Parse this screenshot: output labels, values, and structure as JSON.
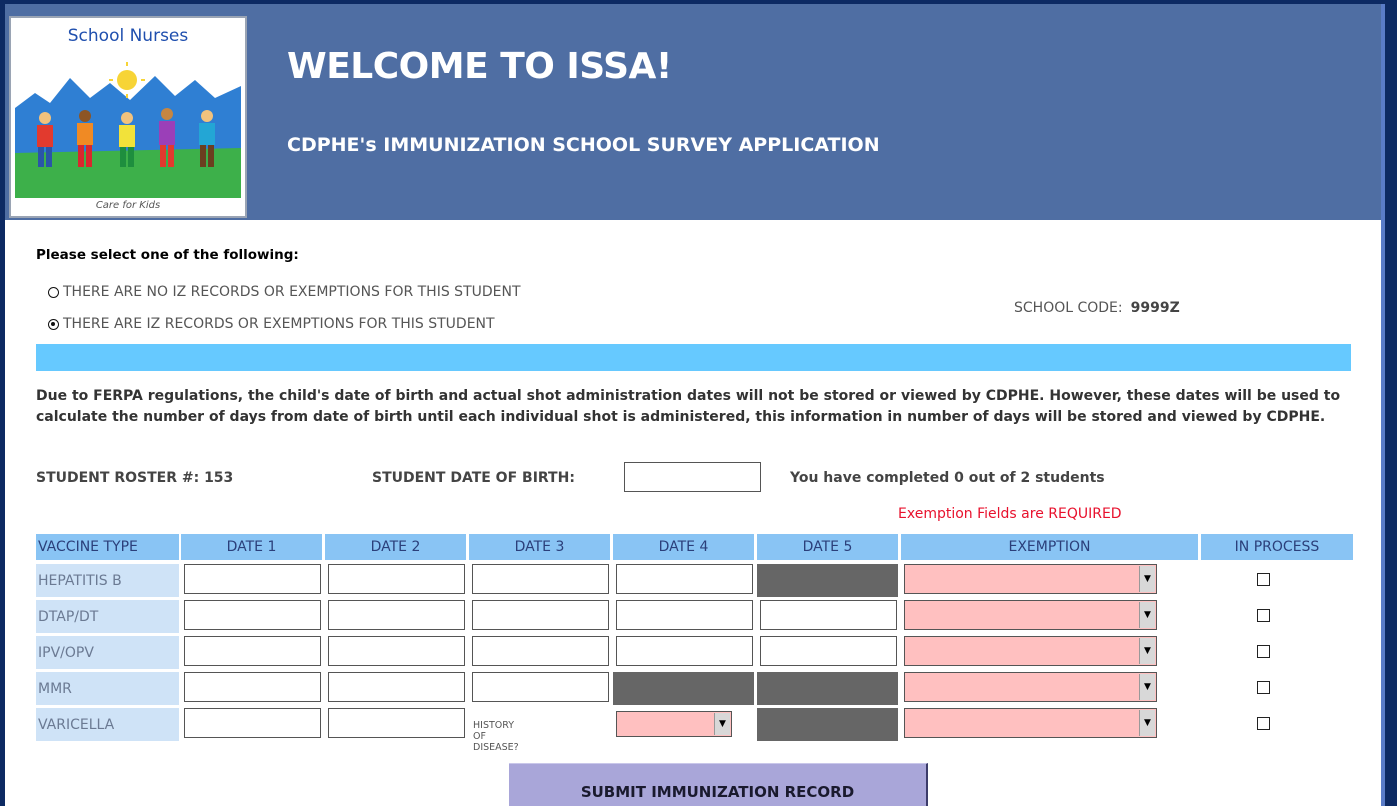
{
  "header": {
    "logo_top_text": "School Nurses",
    "logo_bottom_text": "Care for Kids",
    "title": "WELCOME TO ISSA!",
    "subtitle": "CDPHE's IMMUNIZATION SCHOOL SURVEY APPLICATION"
  },
  "selection": {
    "prompt": "Please select one of the following:",
    "options": [
      {
        "label": "THERE ARE NO IZ RECORDS OR EXEMPTIONS FOR THIS STUDENT",
        "checked": false
      },
      {
        "label": "THERE ARE IZ RECORDS OR EXEMPTIONS FOR THIS STUDENT",
        "checked": true
      }
    ]
  },
  "school": {
    "label": "SCHOOL CODE:",
    "value": "9999Z"
  },
  "notice": "Due to FERPA regulations, the child's date of birth and actual shot administration dates will not be stored or viewed by CDPHE. However, these dates will be used to calculate the number of days from date of birth until each individual shot is administered, this information in number of days will be stored and viewed by CDPHE.",
  "student": {
    "roster_label": "STUDENT ROSTER #:",
    "roster_value": "153",
    "dob_label": "STUDENT DATE OF BIRTH:",
    "dob_value": "",
    "progress_text": "You have completed 0  out of 2 students"
  },
  "required_note": "Exemption Fields are REQUIRED",
  "table": {
    "headers": [
      "VACCINE TYPE",
      "DATE 1",
      "DATE 2",
      "DATE 3",
      "DATE 4",
      "DATE 5",
      "EXEMPTION",
      "IN PROCESS"
    ],
    "rows": [
      {
        "label": "HEPATITIS B"
      },
      {
        "label": "DTAP/DT"
      },
      {
        "label": "IPV/OPV"
      },
      {
        "label": "MMR"
      },
      {
        "label": "VARICELLA"
      }
    ],
    "history_label": "HISTORY OF DISEASE?"
  },
  "submit_label": "SUBMIT IMMUNIZATION RECORD",
  "colors": {
    "banner": "#4f6ea3",
    "frame": "#0d2a63",
    "blue_bar": "#66c9ff",
    "header_cell": "#89c4f4",
    "label_cell": "#cfe3f7",
    "exemption_bg": "#ffc0c0",
    "disabled_cell": "#666666",
    "required_text": "#e8112d",
    "submit_bg": "#a9a6d9"
  }
}
